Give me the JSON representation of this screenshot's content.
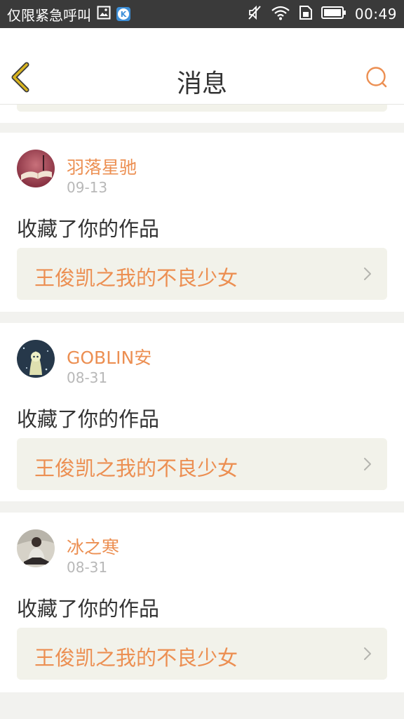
{
  "status_bar": {
    "carrier_text": "仅限紧急呼叫",
    "time": "00:49",
    "icons": [
      "image-icon",
      "k-app-icon",
      "silent-icon",
      "wifi-icon",
      "sim-icon",
      "battery-icon"
    ],
    "background": "#3a3a3a"
  },
  "header": {
    "title": "消息",
    "back_icon": "chevron-left-icon",
    "search_icon": "search-icon",
    "accent_color": "#ec8f52"
  },
  "feed": [
    {
      "username": "羽落星驰",
      "date": "09-13",
      "action": "收藏了你的作品",
      "work_title": "王俊凯之我的不良少女"
    },
    {
      "username": "GOBLIN安",
      "date": "08-31",
      "action": "收藏了你的作品",
      "work_title": "王俊凯之我的不良少女"
    },
    {
      "username": "冰之寒",
      "date": "08-31",
      "action": "收藏了你的作品",
      "work_title": "王俊凯之我的不良少女"
    }
  ]
}
